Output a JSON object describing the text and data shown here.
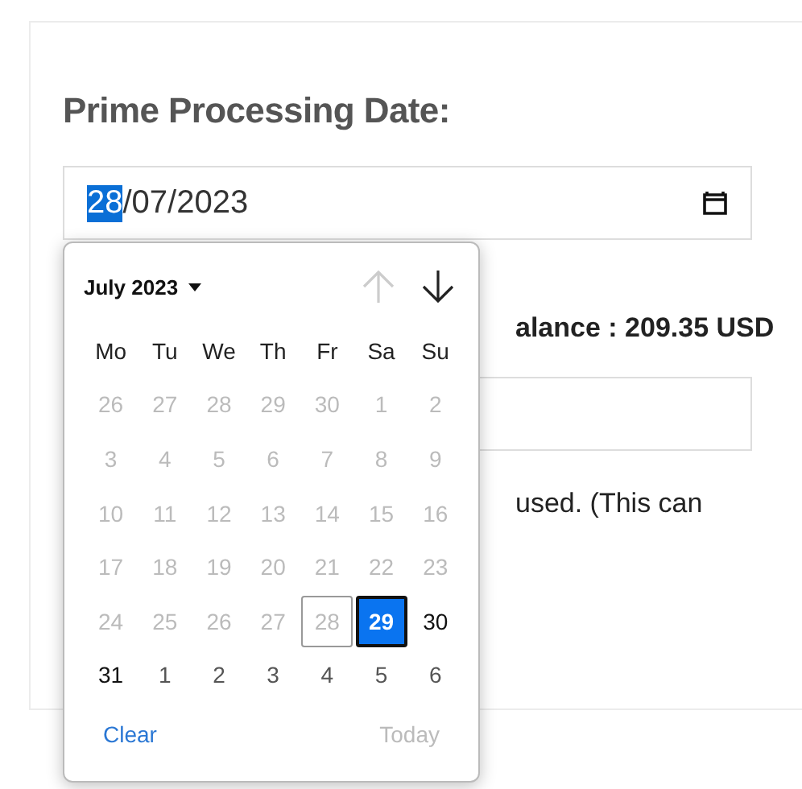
{
  "form": {
    "label": "Prime Processing Date:",
    "date_field": {
      "day": "28",
      "rest": "/07/2023"
    },
    "balance_text": "alance : 209.35 USD",
    "note_text": "used. (This can"
  },
  "date_picker": {
    "month_label": "July 2023",
    "prev_disabled": true,
    "next_disabled": false,
    "weekdays": [
      "Mo",
      "Tu",
      "We",
      "Th",
      "Fr",
      "Sa",
      "Su"
    ],
    "days": [
      {
        "label": "26",
        "disabled": true,
        "selected": false,
        "today": false,
        "outside": true
      },
      {
        "label": "27",
        "disabled": true,
        "selected": false,
        "today": false,
        "outside": true
      },
      {
        "label": "28",
        "disabled": true,
        "selected": false,
        "today": false,
        "outside": true
      },
      {
        "label": "29",
        "disabled": true,
        "selected": false,
        "today": false,
        "outside": true
      },
      {
        "label": "30",
        "disabled": true,
        "selected": false,
        "today": false,
        "outside": true
      },
      {
        "label": "1",
        "disabled": true,
        "selected": false,
        "today": false,
        "outside": false
      },
      {
        "label": "2",
        "disabled": true,
        "selected": false,
        "today": false,
        "outside": false
      },
      {
        "label": "3",
        "disabled": true,
        "selected": false,
        "today": false,
        "outside": false
      },
      {
        "label": "4",
        "disabled": true,
        "selected": false,
        "today": false,
        "outside": false
      },
      {
        "label": "5",
        "disabled": true,
        "selected": false,
        "today": false,
        "outside": false
      },
      {
        "label": "6",
        "disabled": true,
        "selected": false,
        "today": false,
        "outside": false
      },
      {
        "label": "7",
        "disabled": true,
        "selected": false,
        "today": false,
        "outside": false
      },
      {
        "label": "8",
        "disabled": true,
        "selected": false,
        "today": false,
        "outside": false
      },
      {
        "label": "9",
        "disabled": true,
        "selected": false,
        "today": false,
        "outside": false
      },
      {
        "label": "10",
        "disabled": true,
        "selected": false,
        "today": false,
        "outside": false
      },
      {
        "label": "11",
        "disabled": true,
        "selected": false,
        "today": false,
        "outside": false
      },
      {
        "label": "12",
        "disabled": true,
        "selected": false,
        "today": false,
        "outside": false
      },
      {
        "label": "13",
        "disabled": true,
        "selected": false,
        "today": false,
        "outside": false
      },
      {
        "label": "14",
        "disabled": true,
        "selected": false,
        "today": false,
        "outside": false
      },
      {
        "label": "15",
        "disabled": true,
        "selected": false,
        "today": false,
        "outside": false
      },
      {
        "label": "16",
        "disabled": true,
        "selected": false,
        "today": false,
        "outside": false
      },
      {
        "label": "17",
        "disabled": true,
        "selected": false,
        "today": false,
        "outside": false
      },
      {
        "label": "18",
        "disabled": true,
        "selected": false,
        "today": false,
        "outside": false
      },
      {
        "label": "19",
        "disabled": true,
        "selected": false,
        "today": false,
        "outside": false
      },
      {
        "label": "20",
        "disabled": true,
        "selected": false,
        "today": false,
        "outside": false
      },
      {
        "label": "21",
        "disabled": true,
        "selected": false,
        "today": false,
        "outside": false
      },
      {
        "label": "22",
        "disabled": true,
        "selected": false,
        "today": false,
        "outside": false
      },
      {
        "label": "23",
        "disabled": true,
        "selected": false,
        "today": false,
        "outside": false
      },
      {
        "label": "24",
        "disabled": true,
        "selected": false,
        "today": false,
        "outside": false
      },
      {
        "label": "25",
        "disabled": true,
        "selected": false,
        "today": false,
        "outside": false
      },
      {
        "label": "26",
        "disabled": true,
        "selected": false,
        "today": false,
        "outside": false
      },
      {
        "label": "27",
        "disabled": true,
        "selected": false,
        "today": false,
        "outside": false
      },
      {
        "label": "28",
        "disabled": true,
        "selected": false,
        "today": true,
        "outside": false
      },
      {
        "label": "29",
        "disabled": false,
        "selected": true,
        "today": false,
        "outside": false
      },
      {
        "label": "30",
        "disabled": false,
        "selected": false,
        "today": false,
        "outside": false
      },
      {
        "label": "31",
        "disabled": false,
        "selected": false,
        "today": false,
        "outside": false
      },
      {
        "label": "1",
        "disabled": false,
        "selected": false,
        "today": false,
        "outside": true
      },
      {
        "label": "2",
        "disabled": false,
        "selected": false,
        "today": false,
        "outside": true
      },
      {
        "label": "3",
        "disabled": false,
        "selected": false,
        "today": false,
        "outside": true
      },
      {
        "label": "4",
        "disabled": false,
        "selected": false,
        "today": false,
        "outside": true
      },
      {
        "label": "5",
        "disabled": false,
        "selected": false,
        "today": false,
        "outside": true
      },
      {
        "label": "6",
        "disabled": false,
        "selected": false,
        "today": false,
        "outside": true
      }
    ],
    "clear_label": "Clear",
    "today_label": "Today",
    "today_disabled": true
  }
}
